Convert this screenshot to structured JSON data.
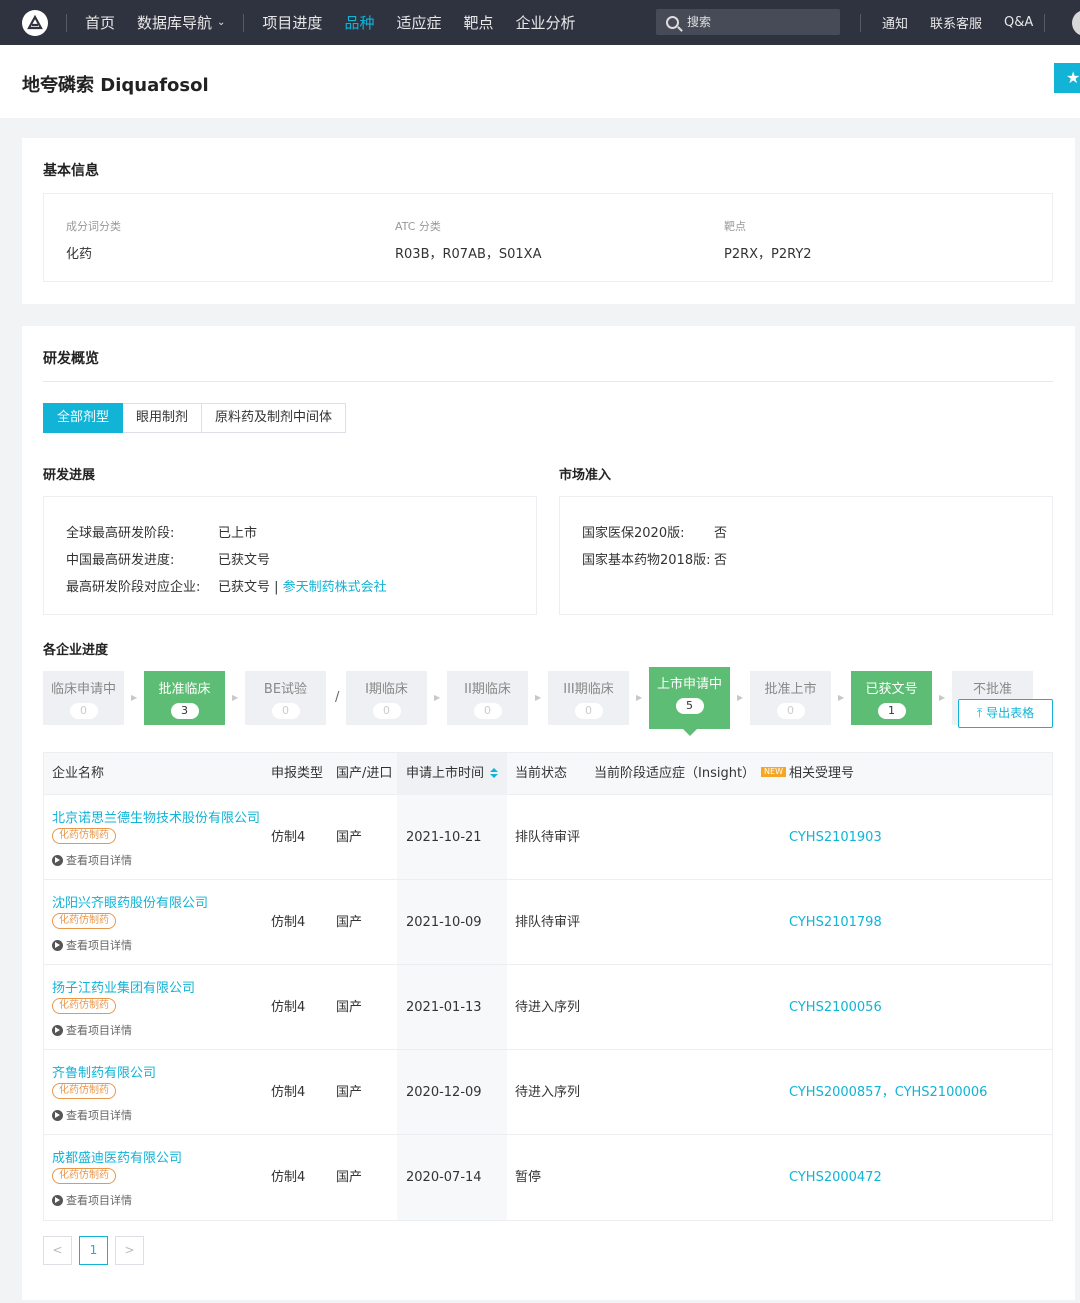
{
  "nav": {
    "items": [
      {
        "label": "首页",
        "active": false,
        "dropdown": false
      },
      {
        "label": "数据库导航",
        "active": false,
        "dropdown": true
      },
      {
        "label": "项目进度",
        "active": false,
        "dropdown": false
      },
      {
        "label": "品种",
        "active": true,
        "dropdown": false
      },
      {
        "label": "适应症",
        "active": false,
        "dropdown": false
      },
      {
        "label": "靶点",
        "active": false,
        "dropdown": false
      },
      {
        "label": "企业分析",
        "active": false,
        "dropdown": false
      }
    ],
    "search_placeholder": "搜索",
    "right_links": [
      "通知",
      "联系客服",
      "Q&A"
    ]
  },
  "page": {
    "title": "地夸磷索 Diquafosol",
    "star_icon": "★"
  },
  "basic": {
    "title": "基本信息",
    "fields": [
      {
        "label": "成分词分类",
        "value": "化药"
      },
      {
        "label": "ATC 分类",
        "value": "R03B，R07AB，S01XA"
      },
      {
        "label": "靶点",
        "value": "P2RX，P2RY2"
      }
    ]
  },
  "rd": {
    "title": "研发概览",
    "tabs": [
      {
        "label": "全部剂型",
        "active": true
      },
      {
        "label": "眼用制剂",
        "active": false
      },
      {
        "label": "原料药及制剂中间体",
        "active": false
      }
    ],
    "progress": {
      "title": "研发进展",
      "rows": [
        {
          "key": "全球最高研发阶段:",
          "value": "已上市"
        },
        {
          "key": "中国最高研发进度:",
          "value": "已获文号"
        },
        {
          "key": "最高研发阶段对应企业:",
          "value": "已获文号 | ",
          "link": "参天制药株式会社"
        }
      ]
    },
    "market": {
      "title": "市场准入",
      "rows": [
        {
          "key": "国家医保2020版:",
          "value": "否"
        },
        {
          "key": "国家基本药物2018版:",
          "value": "否"
        }
      ]
    },
    "companies_title": "各企业进度",
    "stages": [
      {
        "label": "临床申请中",
        "count": "0",
        "state": "gray"
      },
      {
        "label": "批准临床",
        "count": "3",
        "state": "green"
      },
      {
        "label": "BE试验",
        "count": "0",
        "state": "gray"
      },
      {
        "label": "I期临床",
        "count": "0",
        "state": "gray"
      },
      {
        "label": "II期临床",
        "count": "0",
        "state": "gray"
      },
      {
        "label": "III期临床",
        "count": "0",
        "state": "gray"
      },
      {
        "label": "上市申请中",
        "count": "5",
        "state": "current"
      },
      {
        "label": "批准上市",
        "count": "0",
        "state": "gray"
      },
      {
        "label": "已获文号",
        "count": "1",
        "state": "green"
      },
      {
        "label": "不批准",
        "count": "",
        "state": "gray"
      }
    ],
    "export_label": "导出表格",
    "table": {
      "headers": [
        "企业名称",
        "申报类型",
        "国产/进口",
        "申请上市时间",
        "当前状态",
        "当前阶段适应症（Insight）",
        "相关受理号"
      ],
      "new_badge": "NEW",
      "detail_label": "查看项目详情",
      "rows": [
        {
          "company": "北京诺思兰德生物技术股份有限公司",
          "tag": "化药仿制药",
          "type": "仿制4",
          "origin": "国产",
          "date": "2021-10-21",
          "status": "排队待审评",
          "indication": "",
          "numbers": "CYHS2101903"
        },
        {
          "company": "沈阳兴齐眼药股份有限公司",
          "tag": "化药仿制药",
          "type": "仿制4",
          "origin": "国产",
          "date": "2021-10-09",
          "status": "排队待审评",
          "indication": "",
          "numbers": "CYHS2101798"
        },
        {
          "company": "扬子江药业集团有限公司",
          "tag": "化药仿制药",
          "type": "仿制4",
          "origin": "国产",
          "date": "2021-01-13",
          "status": "待进入序列",
          "indication": "",
          "numbers": "CYHS2100056"
        },
        {
          "company": "齐鲁制药有限公司",
          "tag": "化药仿制药",
          "type": "仿制4",
          "origin": "国产",
          "date": "2020-12-09",
          "status": "待进入序列",
          "indication": "",
          "numbers": "CYHS2000857，CYHS2100006"
        },
        {
          "company": "成都盛迪医药有限公司",
          "tag": "化药仿制药",
          "type": "仿制4",
          "origin": "国产",
          "date": "2020-07-14",
          "status": "暂停",
          "indication": "",
          "numbers": "CYHS2000472"
        }
      ]
    },
    "pagination": {
      "prev": "<",
      "current": "1",
      "next": ">"
    }
  },
  "colors": {
    "accent": "#11b3d6",
    "green": "#5ebd74",
    "nav_bg": "#2f3340",
    "tag": "#e8974b"
  }
}
